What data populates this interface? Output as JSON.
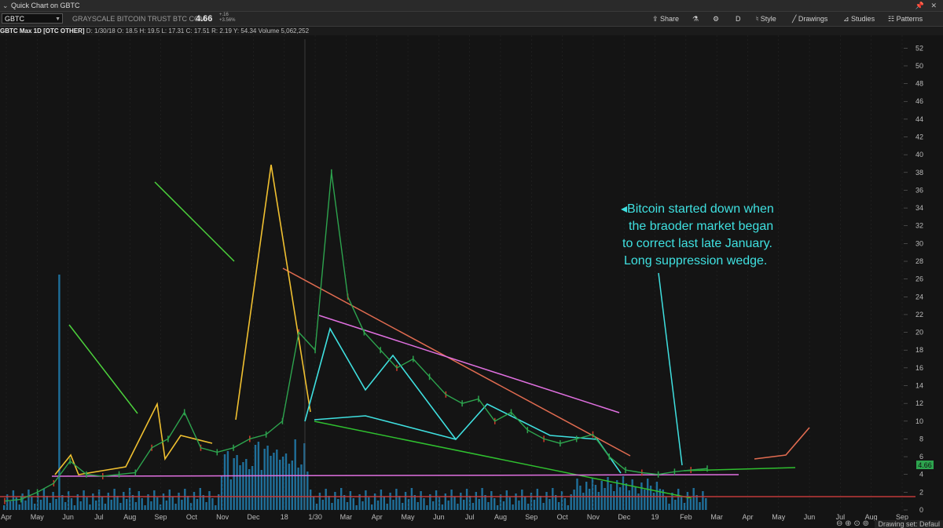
{
  "window": {
    "title": "Quick Chart on GBTC"
  },
  "toolbar": {
    "symbol": "GBTC",
    "description": "GRAYSCALE BITCOIN TRUST BTC COM",
    "last": "4.66",
    "change": "+.16",
    "change_pct": "+3.56%",
    "share": "Share",
    "period": "D",
    "style": "Style",
    "drawings": "Drawings",
    "studies": "Studies",
    "patterns": "Patterns"
  },
  "info": {
    "name": "GBTC Max 1D [OTC OTHER]",
    "date": "D: 1/30/18",
    "open": "O: 18.5",
    "high": "H: 19.5",
    "low": "L: 17.31",
    "close": "C: 17.51",
    "range": "R: 2.19",
    "y": "Y: 54.34",
    "volume": "Volume 5,062,252"
  },
  "annotation": {
    "lines": [
      "Bitcoin started down when",
      "the braoder market began",
      "to correct last late January.",
      "Long suppression wedge."
    ]
  },
  "price_label": "4.66",
  "footer": {
    "drawing_set": "Drawing set: Defaul"
  },
  "colors": {
    "accent": "#3fe0e0",
    "volume": "#1f6f9a",
    "up": "#2da44e",
    "down": "#d33b2b"
  },
  "chart_data": {
    "type": "line",
    "x_ticks": [
      "Apr",
      "May",
      "Jun",
      "Jul",
      "Aug",
      "Sep",
      "Oct",
      "Nov",
      "Dec",
      "18",
      "1/30",
      "Mar",
      "Apr",
      "May",
      "Jun",
      "Jul",
      "Aug",
      "Sep",
      "Oct",
      "Nov",
      "Dec",
      "19",
      "Feb",
      "Mar",
      "Apr",
      "May",
      "Jun",
      "Jul",
      "Aug",
      "Sep"
    ],
    "y_ticks": [
      0,
      2,
      4,
      6,
      8,
      10,
      12,
      14,
      16,
      18,
      20,
      22,
      24,
      26,
      28,
      30,
      32,
      34,
      36,
      38,
      40,
      42,
      44,
      46,
      48,
      50,
      52
    ],
    "ylim": [
      0,
      53
    ],
    "series": [
      {
        "values": [
          1,
          1.2,
          2,
          3,
          5.5,
          4,
          3.8,
          4,
          4.2,
          7,
          8,
          11,
          7,
          6.5,
          7,
          8,
          8.5,
          10,
          20,
          18,
          38,
          24,
          20,
          18,
          16,
          17,
          15,
          13,
          12,
          12.5,
          10,
          11,
          9,
          8,
          7.5,
          8,
          8.5,
          6,
          4.5,
          4.2,
          4,
          4.3,
          4.5,
          4.66
        ]
      }
    ]
  }
}
